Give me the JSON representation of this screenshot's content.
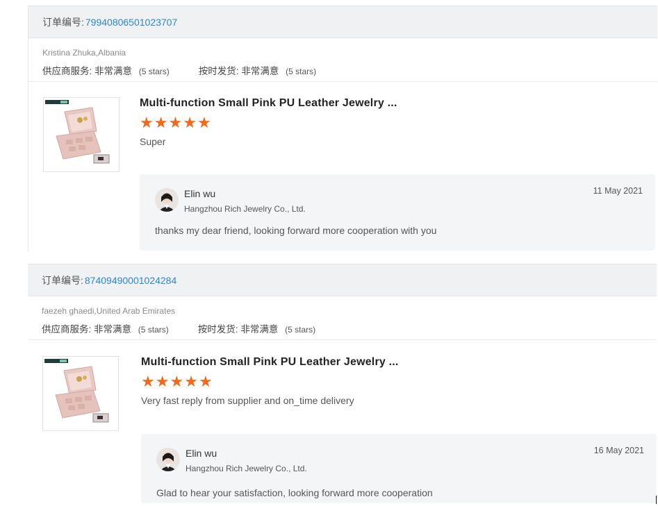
{
  "reviews": [
    {
      "order_label": "订单编号:",
      "order_number": "79940806501023707",
      "buyer": "Kristina Zhuka,Albania",
      "rating_supplier_label": "供应商服务:",
      "rating_supplier_value": "非常满意",
      "rating_supplier_stars": "(5 stars)",
      "rating_delivery_label": "按时发货:",
      "rating_delivery_value": "非常满意",
      "rating_delivery_stars": "(5 stars)",
      "product_title": "Multi-function Small Pink PU Leather Jewelry ...",
      "star_count": 5,
      "comment": "Super",
      "reply": {
        "name": "Elin wu",
        "company": "Hangzhou Rich Jewelry Co., Ltd.",
        "date": "11 May 2021",
        "text": "thanks my dear friend, looking forward more cooperation with you"
      }
    },
    {
      "order_label": "订单编号:",
      "order_number": "87409490001024284",
      "buyer": "faezeh ghaedi,United Arab Emirates",
      "rating_supplier_label": "供应商服务:",
      "rating_supplier_value": "非常满意",
      "rating_supplier_stars": "(5 stars)",
      "rating_delivery_label": "按时发货:",
      "rating_delivery_value": "非常满意",
      "rating_delivery_stars": "(5 stars)",
      "product_title": "Multi-function Small Pink PU Leather Jewelry ...",
      "star_count": 5,
      "comment": "Very fast reply from supplier and on_time delivery",
      "reply": {
        "name": "Elin wu",
        "company": "Hangzhou Rich Jewelry Co., Ltd.",
        "date": "16 May 2021",
        "text": "Glad to hear your satisfaction, looking forward more cooperation"
      }
    }
  ],
  "icons": {
    "star": "star-icon",
    "product_image": "jewelry-box-image",
    "avatar": "avatar-image"
  },
  "colors": {
    "accent_link": "#2b87d3",
    "star": "#f06a1c",
    "order_bar_bg": "#f0f1f3",
    "reply_bg": "#f4f5f7"
  }
}
